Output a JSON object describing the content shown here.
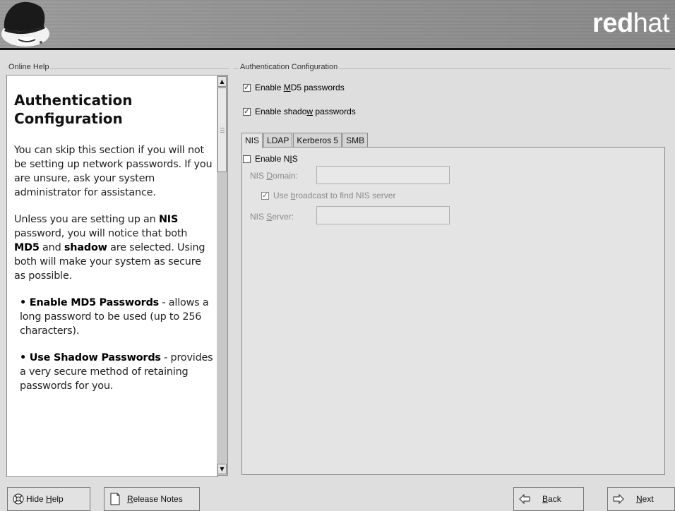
{
  "header": {
    "brand_bold": "red",
    "brand_light": "hat"
  },
  "help": {
    "group_label": "Online Help",
    "title": "Authentication Configuration",
    "p1": "You can skip this section if you will not be setting up network passwords. If you are unsure, ask your system administrator for assistance.",
    "p2_a": "Unless you are setting up an ",
    "p2_nis": "NIS",
    "p2_b": " password, you will notice that both ",
    "p2_md5": "MD5",
    "p2_c": " and ",
    "p2_shadow": "shadow",
    "p2_d": " are selected. Using both will make your system as secure as possible.",
    "item1_bold": "• Enable MD5 Passwords",
    "item1_text": " - allows a long password to be used (up to 256 characters).",
    "item2_bold": "• Use Shadow Passwords",
    "item2_text": " - provides a very secure method of retaining passwords for you."
  },
  "auth": {
    "group_label": "Authentication Configuration",
    "md5": {
      "pre": "Enable ",
      "mn": "M",
      "post": "D5 passwords",
      "checked": true
    },
    "shadow": {
      "pre": "Enable shado",
      "mn": "w",
      "post": " passwords",
      "checked": true
    },
    "tabs": [
      "NIS",
      "LDAP",
      "Kerberos 5",
      "SMB"
    ],
    "active_tab": "NIS",
    "nis": {
      "enable": {
        "pre": "Enable N",
        "mn": "I",
        "post": "S",
        "checked": false
      },
      "domain_label": {
        "pre": "NIS ",
        "mn": "D",
        "post": "omain:"
      },
      "domain_value": "",
      "broadcast": {
        "pre": "Use ",
        "mn": "b",
        "post": "roadcast to find NIS server",
        "checked": true
      },
      "server_label": {
        "pre": "NIS ",
        "mn": "S",
        "post": "erver:"
      },
      "server_value": ""
    }
  },
  "buttons": {
    "hide_help": {
      "pre": "Hide ",
      "mn": "H",
      "post": "elp"
    },
    "release_notes": {
      "pre": "",
      "mn": "R",
      "post": "elease Notes"
    },
    "back": {
      "pre": "",
      "mn": "B",
      "post": "ack"
    },
    "next": {
      "pre": "",
      "mn": "N",
      "post": "ext"
    }
  }
}
